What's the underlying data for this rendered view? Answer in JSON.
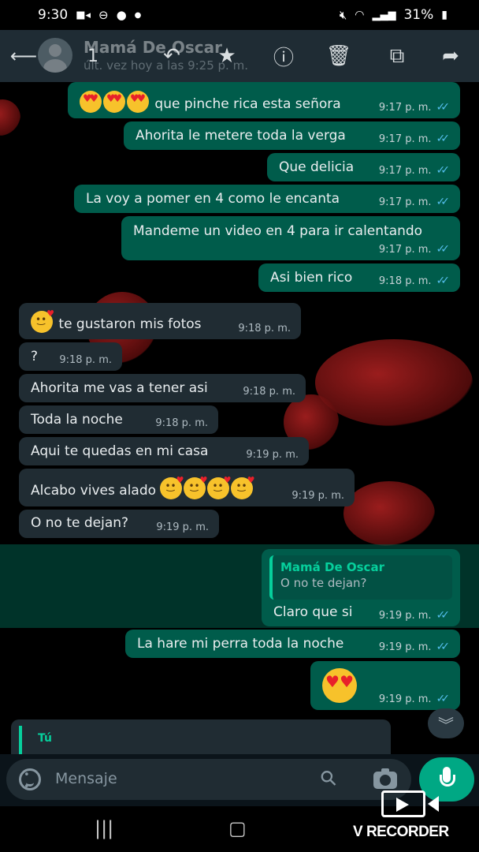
{
  "status_bar": {
    "time": "9:30",
    "battery": "31%"
  },
  "app_bar": {
    "contact_name": "Mamá De Oscar",
    "last_seen": "últ. vez hoy a las 9:25 p. m.",
    "icons": [
      "back-icon",
      "reply-icon",
      "star-icon",
      "info-icon",
      "delete-icon",
      "copy-icon",
      "forward-icon"
    ]
  },
  "messages": [
    {
      "dir": "out",
      "text": "que pinche rica esta señora",
      "emoji": [
        "heart-eyes",
        "heart-eyes",
        "heart-eyes"
      ],
      "time": "9:17 p. m."
    },
    {
      "dir": "out",
      "text": "Ahorita le metere toda la verga",
      "time": "9:17 p. m."
    },
    {
      "dir": "out",
      "text": "Que delicia",
      "time": "9:17 p. m."
    },
    {
      "dir": "out",
      "text": "La voy a pomer en 4 como le encanta",
      "time": "9:17 p. m."
    },
    {
      "dir": "out",
      "text": "Mandeme un video en 4 para ir calentando",
      "time": "9:17 p. m."
    },
    {
      "dir": "out",
      "text": "Asi bien rico",
      "time": "9:18 p. m."
    },
    {
      "dir": "in",
      "text": "te gustaron mis fotos",
      "emoji": [
        "kiss"
      ],
      "time": "9:18 p. m."
    },
    {
      "dir": "in",
      "text": "?",
      "time": "9:18 p. m."
    },
    {
      "dir": "in",
      "text": "Ahorita me vas a tener asi",
      "time": "9:18 p. m."
    },
    {
      "dir": "in",
      "text": "Toda la noche",
      "time": "9:18 p. m."
    },
    {
      "dir": "in",
      "text": "Aqui te quedas en mi casa",
      "time": "9:19 p. m."
    },
    {
      "dir": "in",
      "text": "Alcabo vives alado",
      "emoji": [
        "kiss",
        "kiss",
        "kiss",
        "kiss"
      ],
      "time": "9:19 p. m."
    },
    {
      "dir": "in",
      "text": "O no te dejan?",
      "time": "9:19 p. m."
    },
    {
      "dir": "out",
      "selected": true,
      "quote_name": "Mamá De Oscar",
      "quote_text": "O no te dejan?",
      "text": "Claro que si",
      "time": "9:19 p. m."
    },
    {
      "dir": "out",
      "text": "La hare mi perra toda la noche",
      "time": "9:19 p. m."
    },
    {
      "dir": "out",
      "text": "",
      "emoji": [
        "heart-eyes"
      ],
      "time": "9:19 p. m."
    }
  ],
  "reply_preview": {
    "author": "Tú"
  },
  "input": {
    "placeholder": "Mensaje"
  },
  "watermark": "V RECORDER",
  "colors": {
    "outgoing": "#005c4b",
    "incoming": "#202c33",
    "accent": "#00a884",
    "read_tick": "#53bdeb"
  }
}
